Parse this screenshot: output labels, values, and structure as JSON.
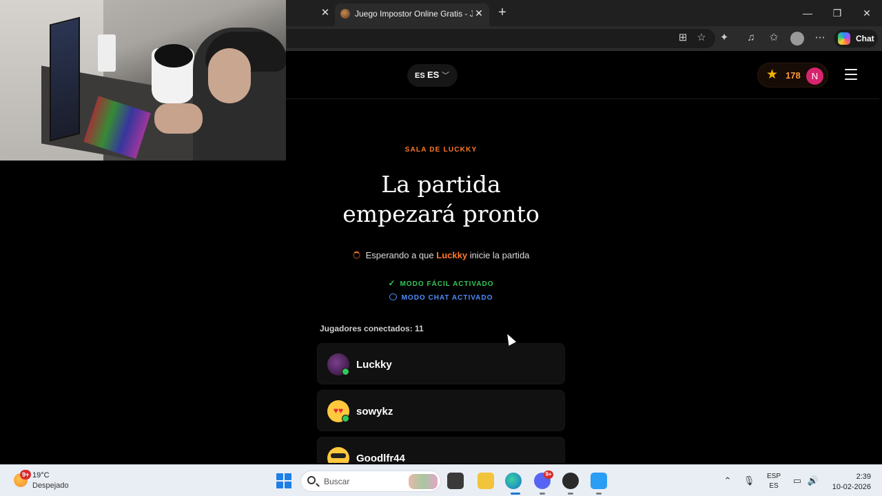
{
  "browser": {
    "active_tab_title": "Juego Impostor Online Gratis - Jueg",
    "chat_label": "Chat"
  },
  "header": {
    "lang_flag": "ES",
    "lang_code": "ES",
    "points": "178",
    "user_initial": "N"
  },
  "lobby": {
    "room_label": "SALA DE LUCKKY",
    "title_line1": "La partida",
    "title_line2": "empezará pronto",
    "waiting_prefix": "Esperando a que",
    "waiting_host": "Luckky",
    "waiting_suffix": "inicie la partida",
    "mode_easy": "MODO FÁCIL ACTIVADO",
    "mode_chat": "MODO CHAT ACTIVADO",
    "players_count_label": "Jugadores conectados: 11",
    "players": [
      {
        "name": "Luckky"
      },
      {
        "name": "sowykz"
      },
      {
        "name": "Goodlfr44"
      }
    ]
  },
  "taskbar": {
    "weather_badge": "9+",
    "temperature": "19°C",
    "weather_desc": "Despejado",
    "search_placeholder": "Buscar",
    "discord_badge": "9+",
    "input_lang_top": "ESP",
    "input_lang_bottom": "ES",
    "time": "2:39",
    "date": "10-02-2026"
  },
  "colors": {
    "accent_orange": "#ff7a29",
    "mode_green": "#34c759",
    "mode_blue": "#4d8dff",
    "avatar_pink": "#d8246f"
  }
}
